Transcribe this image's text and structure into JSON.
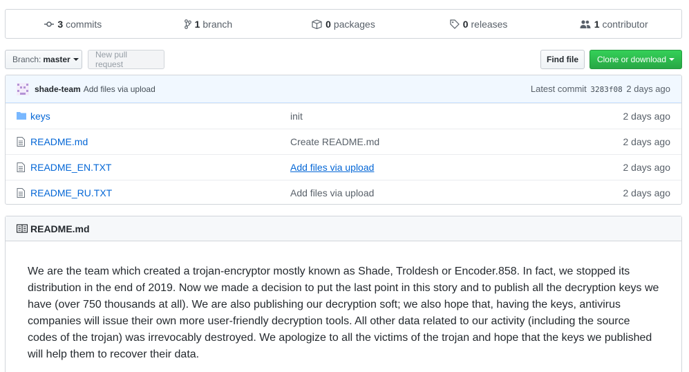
{
  "summary": {
    "commits": {
      "num": "3",
      "label": "commits"
    },
    "branch": {
      "num": "1",
      "label": "branch"
    },
    "packages": {
      "num": "0",
      "label": "packages"
    },
    "releases": {
      "num": "0",
      "label": "releases"
    },
    "contributors": {
      "num": "1",
      "label": "contributor"
    }
  },
  "toolbar": {
    "branch_label": "Branch:",
    "branch_value": "master",
    "new_pr": "New pull request",
    "find_file": "Find file",
    "clone": "Clone or download"
  },
  "commit": {
    "author": "shade-team",
    "message": "Add files via upload",
    "latest_label": "Latest commit",
    "sha": "3283f08",
    "age": "2 days ago"
  },
  "files": [
    {
      "name": "keys",
      "type": "folder",
      "message": "init",
      "age": "2 days ago"
    },
    {
      "name": "README.md",
      "type": "file",
      "message": "Create README.md",
      "age": "2 days ago"
    },
    {
      "name": "README_EN.TXT",
      "type": "file",
      "message": "Add files via upload",
      "age": "2 days ago"
    },
    {
      "name": "README_RU.TXT",
      "type": "file",
      "message": "Add files via upload",
      "age": "2 days ago"
    }
  ],
  "readme": {
    "title": "README.md",
    "body": "We are the team which created a trojan-encryptor mostly known as Shade, Troldesh or Encoder.858. In fact, we stopped its distribution in the end of 2019. Now we made a decision to put the last point in this story and to publish all the decryption keys we have (over 750 thousands at all). We are also publishing our decryption soft; we also hope that, having the keys, antivirus companies will issue their own more user-friendly decryption tools. All other data related to our activity (including the source codes of the trojan) was irrevocably destroyed. We apologize to all the victims of the trojan and hope that the keys we published will help them to recover their data."
  },
  "colors": {
    "link": "#0366d6",
    "clone_green": "#28a745",
    "commit_bar": "#f1f8ff"
  }
}
